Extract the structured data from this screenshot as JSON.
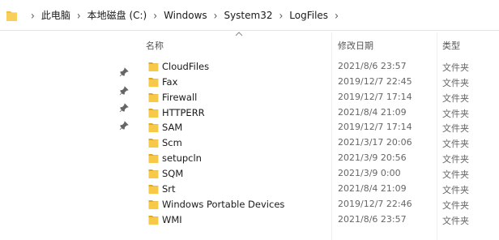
{
  "address_bar": {
    "crumbs": [
      "此电脑",
      "本地磁盘 (C:)",
      "Windows",
      "System32",
      "LogFiles"
    ]
  },
  "columns": {
    "name": "名称",
    "date": "修改日期",
    "type": "类型"
  },
  "rows": [
    {
      "name": "CloudFiles",
      "date": "2021/8/6 23:57",
      "type": "文件夹",
      "pinned": false
    },
    {
      "name": "Fax",
      "date": "2019/12/7 22:45",
      "type": "文件夹",
      "pinned": true
    },
    {
      "name": "Firewall",
      "date": "2019/12/7 17:14",
      "type": "文件夹",
      "pinned": true
    },
    {
      "name": "HTTPERR",
      "date": "2021/8/4 21:09",
      "type": "文件夹",
      "pinned": true
    },
    {
      "name": "SAM",
      "date": "2019/12/7 17:14",
      "type": "文件夹",
      "pinned": true
    },
    {
      "name": "Scm",
      "date": "2021/3/17 20:06",
      "type": "文件夹",
      "pinned": false
    },
    {
      "name": "setupcln",
      "date": "2021/3/9 20:56",
      "type": "文件夹",
      "pinned": false
    },
    {
      "name": "SQM",
      "date": "2021/3/9 0:00",
      "type": "文件夹",
      "pinned": false
    },
    {
      "name": "Srt",
      "date": "2021/8/4 21:09",
      "type": "文件夹",
      "pinned": false
    },
    {
      "name": "Windows Portable Devices",
      "date": "2019/12/7 22:46",
      "type": "文件夹",
      "pinned": false
    },
    {
      "name": "WMI",
      "date": "2021/8/6 23:57",
      "type": "文件夹",
      "pinned": false
    }
  ],
  "colors": {
    "folder": "#f7c948",
    "folder_dark": "#e0a91e",
    "date_text": "#666666"
  }
}
